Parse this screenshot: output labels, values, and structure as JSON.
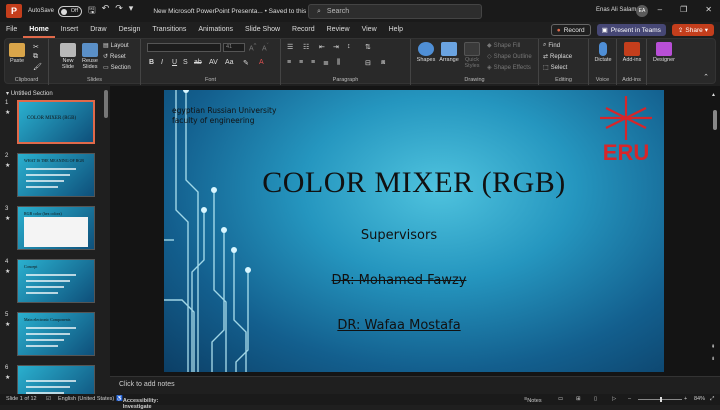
{
  "titlebar": {
    "autosave_label": "AutoSave",
    "autosave_state": "Off",
    "doc_title": "New Microsoft PowerPoint Presenta... • Saved to this PC",
    "search_placeholder": "Search",
    "user_name": "Enas Ali Salama",
    "user_initials": "EA"
  },
  "tabs": [
    "File",
    "Home",
    "Insert",
    "Draw",
    "Design",
    "Transitions",
    "Animations",
    "Slide Show",
    "Record",
    "Review",
    "View",
    "Help"
  ],
  "active_tab": "Home",
  "tab_actions": {
    "record": "Record",
    "present": "Present in Teams",
    "share": "Share"
  },
  "ribbon": {
    "clipboard": {
      "paste": "Paste",
      "label": "Clipboard"
    },
    "slides": {
      "new_slide": "New Slide",
      "reuse": "Reuse Slides",
      "layout": "Layout",
      "reset": "Reset",
      "section": "Section",
      "label": "Slides"
    },
    "font": {
      "size": "41",
      "label": "Font"
    },
    "paragraph": {
      "label": "Paragraph"
    },
    "drawing": {
      "shapes": "Shapes",
      "arrange": "Arrange",
      "quick_styles": "Quick Styles",
      "fill": "Shape Fill",
      "outline": "Shape Outline",
      "effects": "Shape Effects",
      "label": "Drawing"
    },
    "editing": {
      "find": "Find",
      "replace": "Replace",
      "select": "Select",
      "label": "Editing"
    },
    "voice": {
      "dictate": "Dictate",
      "label": "Voice"
    },
    "addins": {
      "addins": "Add-ins",
      "label": "Add-ins"
    },
    "designer": {
      "designer": "Designer"
    }
  },
  "panel": {
    "section_title": "Untitled Section",
    "thumbnails": [
      {
        "num": "1",
        "title": "COLOR MIXER (RGB)"
      },
      {
        "num": "2",
        "title": "WHAT IS THE MEANING OF RGB"
      },
      {
        "num": "3",
        "title": "RGB color (hex colors)"
      },
      {
        "num": "4",
        "title": "Concept"
      },
      {
        "num": "5",
        "title": "Main electronic Components"
      },
      {
        "num": "6",
        "title": ""
      }
    ]
  },
  "slide": {
    "university": "egyptian Russian University",
    "faculty": "faculty of engineering",
    "logo_text": "ERU",
    "title": "COLOR MIXER (RGB)",
    "subtitle": "Supervisors",
    "supervisor1": "DR: Mohamed Fawzy",
    "supervisor2": "DR: Wafaa Mostafa"
  },
  "notes_placeholder": "Click to add notes",
  "status": {
    "slide_indicator": "Slide 1 of 12",
    "language": "English (United States)",
    "accessibility": "Accessibility: Investigate",
    "notes": "Notes",
    "zoom": "84%"
  },
  "colors": {
    "accent": "#e0694a",
    "share": "#c43e1c",
    "teams": "#464775",
    "logo_red": "#d6262a"
  }
}
